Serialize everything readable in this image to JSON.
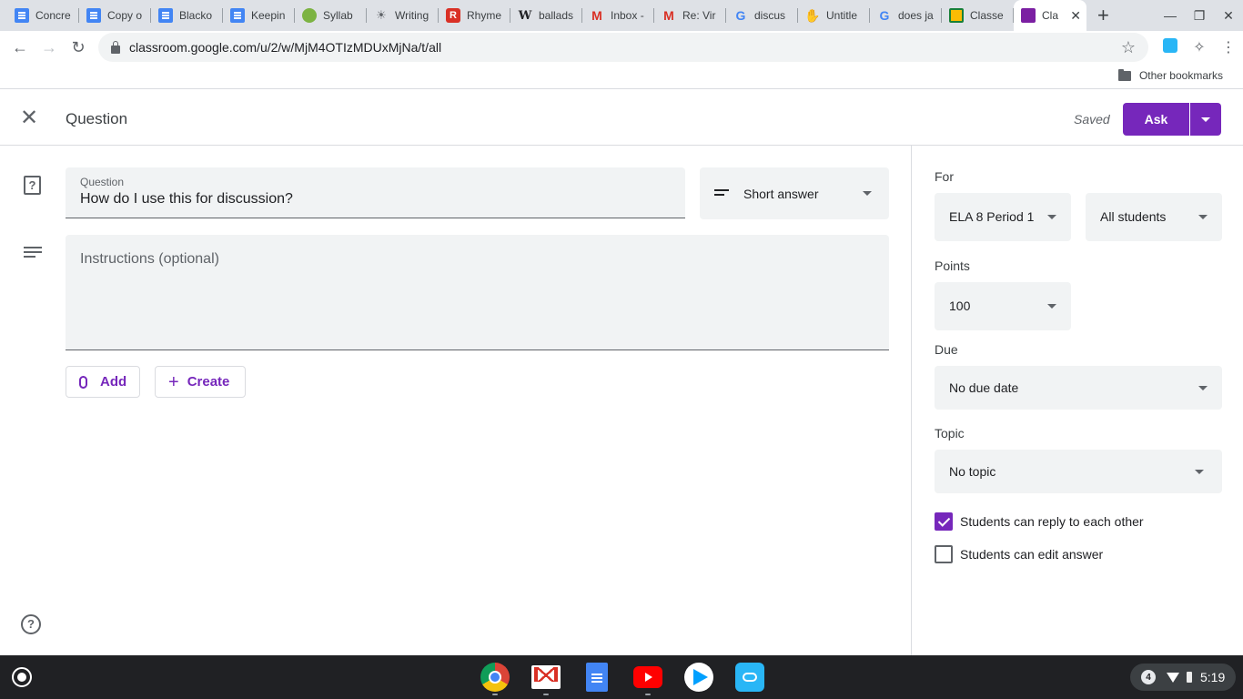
{
  "browser": {
    "tabs": [
      {
        "title": "Concre",
        "icon": "docs-icon",
        "active": false
      },
      {
        "title": "Copy o",
        "icon": "docs-icon",
        "active": false
      },
      {
        "title": "Blacko",
        "icon": "docs-icon",
        "active": false
      },
      {
        "title": "Keepin",
        "icon": "docs-icon",
        "active": false
      },
      {
        "title": "Syllab",
        "icon": "leaf-icon",
        "active": false
      },
      {
        "title": "Writing",
        "icon": "lightbulb-icon",
        "active": false
      },
      {
        "title": "Rhyme",
        "icon": "rhymezone-icon",
        "active": false
      },
      {
        "title": "ballads",
        "icon": "wikipedia-icon",
        "active": false
      },
      {
        "title": "Inbox -",
        "icon": "gmail-icon",
        "active": false
      },
      {
        "title": "Re: Vir",
        "icon": "gmail-icon",
        "active": false
      },
      {
        "title": "discus",
        "icon": "google-icon",
        "active": false
      },
      {
        "title": "Untitle",
        "icon": "hand-icon",
        "active": false
      },
      {
        "title": "does ja",
        "icon": "google-icon",
        "active": false
      },
      {
        "title": "Classe",
        "icon": "classroom-icon",
        "active": false
      },
      {
        "title": "Cla",
        "icon": "classroom-purple-icon",
        "active": true
      }
    ],
    "new_tab_glyph": "+",
    "url": "classroom.google.com/u/2/w/MjM4OTIzMDUxMjNa/t/all",
    "bookmarks": {
      "other_label": "Other bookmarks"
    }
  },
  "header": {
    "title": "Question",
    "saved_label": "Saved",
    "ask_label": "Ask"
  },
  "question": {
    "label": "Question",
    "value": "How do I use this for discussion?",
    "type_label": "Short answer"
  },
  "instructions": {
    "placeholder": "Instructions (optional)"
  },
  "attachments": {
    "add_label": "Add",
    "create_label": "Create"
  },
  "settings": {
    "for_label": "For",
    "class_value": "ELA 8 Period 1",
    "students_value": "All students",
    "points_label": "Points",
    "points_value": "100",
    "due_label": "Due",
    "due_value": "No due date",
    "topic_label": "Topic",
    "topic_value": "No topic",
    "reply_label": "Students can reply to each other",
    "reply_checked": true,
    "edit_label": "Students can edit answer",
    "edit_checked": false
  },
  "shelf": {
    "apps": [
      "chrome-icon",
      "gmail-icon",
      "docs-icon",
      "youtube-icon",
      "play-store-icon",
      "cloud-icon"
    ],
    "notification_count": "4",
    "time": "5:19"
  },
  "colors": {
    "accent": "#7627bb",
    "field_bg": "#f1f3f4"
  }
}
